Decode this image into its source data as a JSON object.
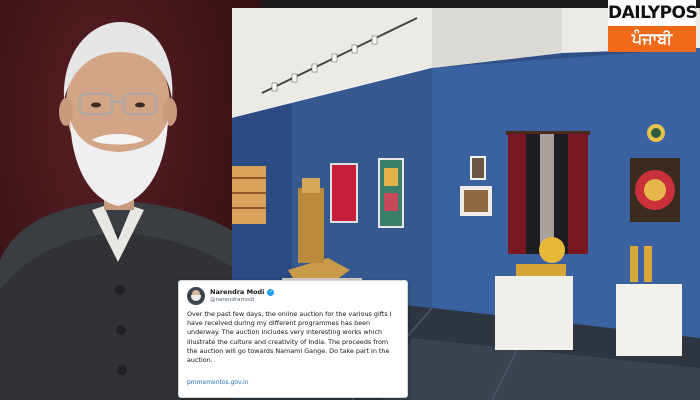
{
  "logo": {
    "line1_a": "DAILY",
    "line1_dot": "",
    "line1_b": "POST",
    "line2": "ਪੰਜਾਬੀ"
  },
  "tweet": {
    "author_name": "Narendra Modi",
    "author_handle": "@narendramodi",
    "body": "Over the past few days, the online auction for the various gifts I have received during my different programmes has been underway. The auction includes very interesting works which illustrate the culture and creativity of India. The proceeds from the auction will go towards Namami Gange. Do take part in the auction.",
    "link": "pmmementos.gov.in"
  },
  "colors": {
    "portrait_bg": "#4a1a1f",
    "gallery_wall": "#2f4f86",
    "logo_accent": "#f06a1a",
    "link": "#1d6fb8",
    "verified": "#1d9bf0"
  }
}
